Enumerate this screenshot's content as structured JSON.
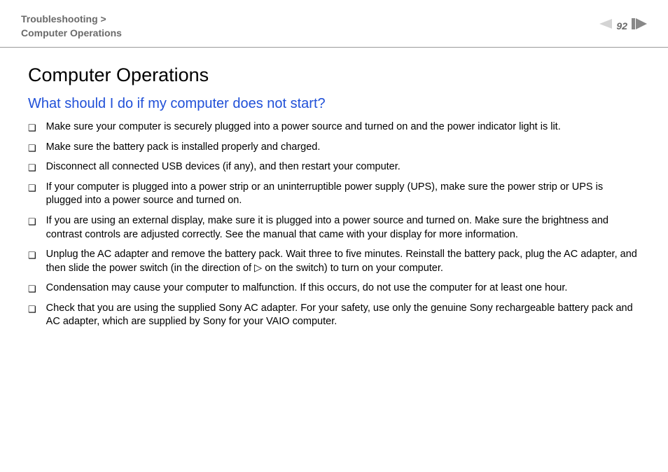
{
  "header": {
    "breadcrumb_line1": "Troubleshooting >",
    "breadcrumb_line2": "Computer Operations",
    "page_number": "92"
  },
  "main": {
    "title": "Computer Operations",
    "section_heading": "What should I do if my computer does not start?",
    "bullets": [
      "Make sure your computer is securely plugged into a power source and turned on and the power indicator light is lit.",
      "Make sure the battery pack is installed properly and charged.",
      "Disconnect all connected USB devices (if any), and then restart your computer.",
      "If your computer is plugged into a power strip or an uninterruptible power supply (UPS), make sure the power strip or UPS is plugged into a power source and turned on.",
      "If you are using an external display, make sure it is plugged into a power source and turned on. Make sure the brightness and contrast controls are adjusted correctly. See the manual that came with your display for more information.",
      "Unplug the AC adapter and remove the battery pack. Wait three to five minutes. Reinstall the battery pack, plug the AC adapter, and then slide the power switch (in the direction of ▷ on the switch) to turn on your computer.",
      "Condensation may cause your computer to malfunction. If this occurs, do not use the computer for at least one hour.",
      "Check that you are using the supplied Sony AC adapter. For your safety, use only the genuine Sony rechargeable battery pack and AC adapter, which are supplied by Sony for your VAIO computer."
    ]
  }
}
